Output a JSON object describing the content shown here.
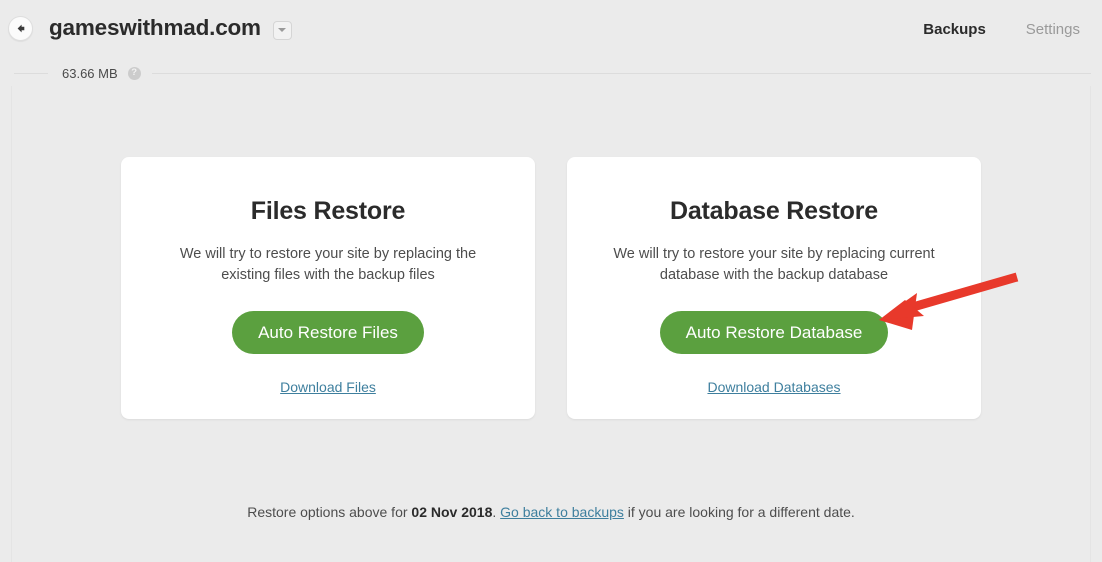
{
  "header": {
    "back_icon": "arrow-left-icon",
    "site_title": "gameswithmad.com",
    "dropdown_icon": "chevron-down-icon",
    "nav": [
      {
        "label": "Backups",
        "active": true
      },
      {
        "label": "Settings",
        "active": false
      }
    ]
  },
  "meta": {
    "size_label": "63.66 MB",
    "help_icon": "question-mark-icon",
    "help_glyph": "?"
  },
  "cards": [
    {
      "title": "Files Restore",
      "description": "We will try to restore your site by replacing the existing files with the backup files",
      "button_label": "Auto Restore Files",
      "link_label": "Download Files"
    },
    {
      "title": "Database Restore",
      "description": "We will try to restore your site by replacing current database with the backup database",
      "button_label": "Auto Restore Database",
      "link_label": "Download Databases"
    }
  ],
  "footer": {
    "prefix": "Restore options above for ",
    "date": "02 Nov 2018",
    "separator": ". ",
    "link_label": "Go back to backups",
    "suffix": " if you are looking for a different date."
  },
  "colors": {
    "accent_green": "#5ba03f",
    "link_blue": "#3e7f9e",
    "annotation_red": "#e8392b",
    "page_bg": "#ebebeb",
    "card_bg": "#ffffff"
  },
  "annotation": {
    "type": "arrow",
    "target": "Auto Restore Database",
    "color": "#e8392b"
  }
}
